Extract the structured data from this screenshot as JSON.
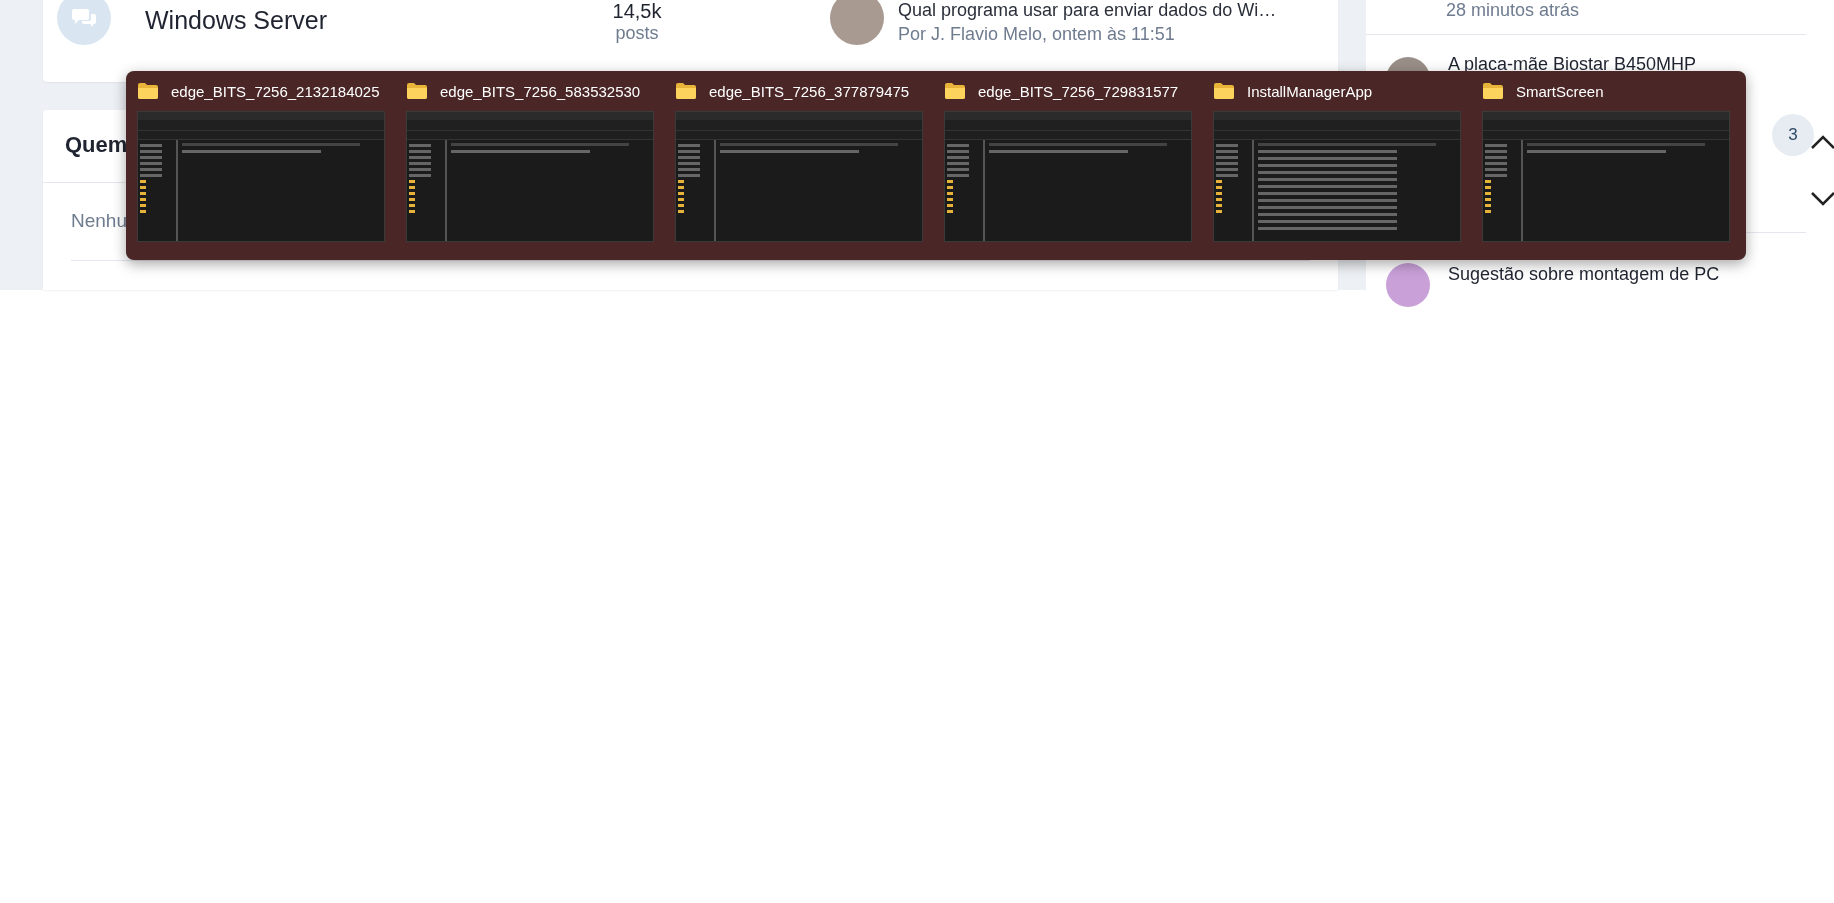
{
  "forum_row": {
    "title": "Windows Server",
    "count": "14,5k",
    "count_label": "posts",
    "last_post_title": "Qual programa usar para enviar dados do Wi…",
    "last_post_meta": "Por J. Flavio Melo, ontem às 11:51"
  },
  "who_card": {
    "title": "Quem",
    "text": "Nenhu"
  },
  "activity": {
    "items": [
      {
        "meta": "28 minutos atrás"
      },
      {
        "title": "A placa-mãe Biostar B450MHP",
        "badge": "3"
      },
      {
        "title": "Sugestão sobre montagem de PC"
      }
    ]
  },
  "taskbar_preview": {
    "windows": [
      {
        "title": "edge_BITS_7256_2132184025",
        "kind": "single_file"
      },
      {
        "title": "edge_BITS_7256_583532530",
        "kind": "single_file"
      },
      {
        "title": "edge_BITS_7256_377879475",
        "kind": "single_file"
      },
      {
        "title": "edge_BITS_7256_729831577",
        "kind": "single_file"
      },
      {
        "title": "InstallManagerApp",
        "kind": "many_files"
      },
      {
        "title": "SmartScreen",
        "kind": "single_file"
      }
    ]
  }
}
